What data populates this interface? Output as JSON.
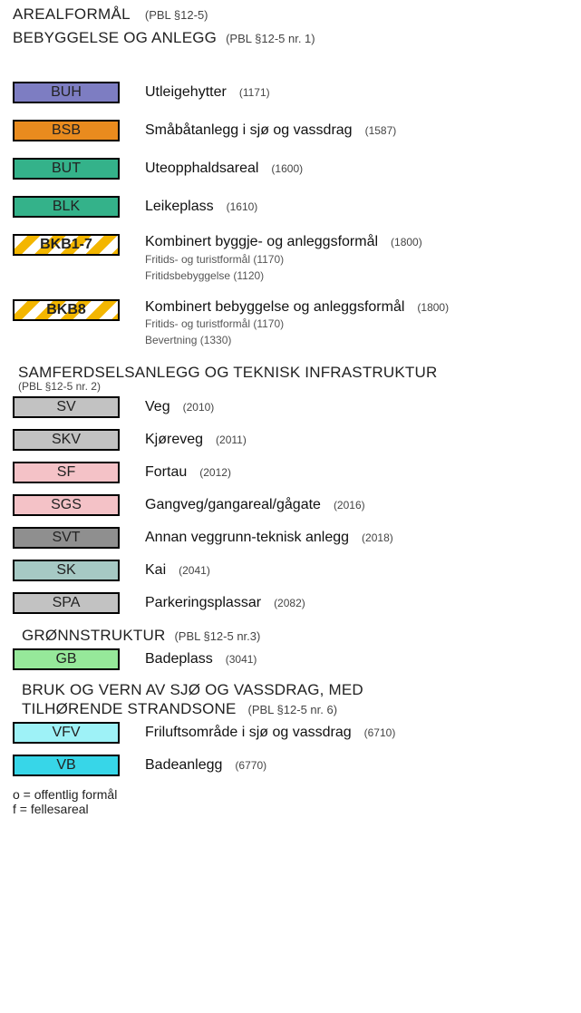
{
  "header": {
    "title": "AREALFORMÅL",
    "title_ref": "(PBL §12-5)"
  },
  "section1": {
    "title": "BEBYGGELSE OG ANLEGG",
    "ref": "(PBL §12-5 nr. 1)"
  },
  "items1": {
    "buh": {
      "code": "BUH",
      "label": "Utleigehytter",
      "num": "(1171)",
      "fill": "#7d7dc2"
    },
    "bsb": {
      "code": "BSB",
      "label": "Småbåtanlegg i sjø og vassdrag",
      "num": "(1587)",
      "fill": "#e98b1e"
    },
    "but": {
      "code": "BUT",
      "label": "Uteopphaldsareal",
      "num": "(1600)",
      "fill": "#34b28a"
    },
    "blk": {
      "code": "BLK",
      "label": "Leikeplass",
      "num": "(1610)",
      "fill": "#34b28a"
    },
    "bkb17": {
      "code": "BKB1-7",
      "label": "Kombinert byggje- og anleggsformål",
      "num": "(1800)",
      "sub1": "Fritids- og turistformål (1170)",
      "sub2": "Fritidsbebyggelse (1120)"
    },
    "bkb8": {
      "code": "BKB8",
      "label": "Kombinert bebyggelse og anleggsformål",
      "num": "(1800)",
      "sub1": "Fritids- og turistformål (1170)",
      "sub2": "Bevertning (1330)"
    }
  },
  "section2": {
    "title": "SAMFERDSELSANLEGG OG TEKNISK INFRASTRUKTUR",
    "ref": "(PBL §12-5 nr. 2)"
  },
  "items2": {
    "sv": {
      "code": "SV",
      "label": "Veg",
      "num": "(2010)",
      "fill": "#c2c2c2"
    },
    "skv": {
      "code": "SKV",
      "label": "Kjøreveg",
      "num": "(2011)",
      "fill": "#c2c2c2"
    },
    "sf": {
      "code": "SF",
      "label": "Fortau",
      "num": "(2012)",
      "fill": "#f4c2c7"
    },
    "sgs": {
      "code": "SGS",
      "label": "Gangveg/gangareal/gågate",
      "num": "(2016)",
      "fill": "#f4c2c7"
    },
    "svt": {
      "code": "SVT",
      "label": "Annan veggrunn-teknisk anlegg",
      "num": "(2018)",
      "fill": "#8f8f8f"
    },
    "sk": {
      "code": "SK",
      "label": "Kai",
      "num": "(2041)",
      "fill": "#a6c9c4"
    },
    "spa": {
      "code": "SPA",
      "label": "Parkeringsplassar",
      "num": "(2082)",
      "fill": "#c2c2c2"
    }
  },
  "section3": {
    "title": "GRØNNSTRUKTUR",
    "ref": "(PBL §12-5 nr.3)"
  },
  "items3": {
    "gb": {
      "code": "GB",
      "label": "Badeplass",
      "num": "(3041)",
      "fill": "#96e89a"
    }
  },
  "section4": {
    "line1": "BRUK OG VERN AV SJØ OG VASSDRAG, MED",
    "line2": "TILHØRENDE STRANDSONE",
    "ref": "(PBL §12-5 nr. 6)"
  },
  "items4": {
    "vfv": {
      "code": "VFV",
      "label": "Friluftsområde i sjø og vassdrag",
      "num": "(6710)",
      "fill": "#9ef2f7"
    },
    "vb": {
      "code": "VB",
      "label": "Badeanlegg",
      "num": "(6770)",
      "fill": "#37d6e8"
    }
  },
  "footnote": {
    "l1": "o = offentlig formål",
    "l2": "f = fellesareal"
  }
}
